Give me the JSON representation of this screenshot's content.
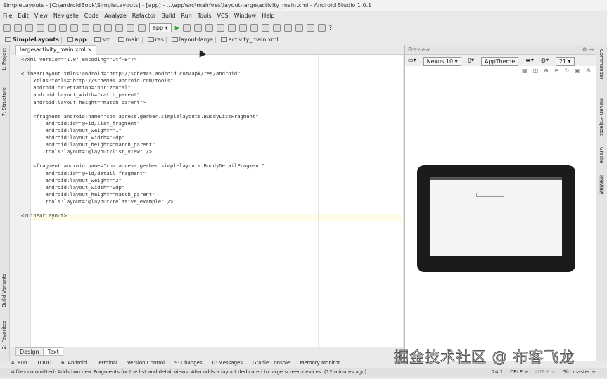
{
  "window": {
    "title": "SimpleLayouts - [C:\\androidBook\\SimpleLayouts] - [app] - ...\\app\\src\\main\\res\\layout-large\\activity_main.xml - Android Studio 1.0.1"
  },
  "menu": [
    "File",
    "Edit",
    "View",
    "Navigate",
    "Code",
    "Analyze",
    "Refactor",
    "Build",
    "Run",
    "Tools",
    "VCS",
    "Window",
    "Help"
  ],
  "toolbar": {
    "run_config": "app ▾",
    "help": "?"
  },
  "breadcrumbs": [
    "SimpleLayouts",
    "app",
    "src",
    "main",
    "res",
    "layout-large",
    "activity_main.xml"
  ],
  "editor_tab": {
    "label": "large\\activity_main.xml",
    "close": "×"
  },
  "left_tools": [
    "1: Project",
    "7: Structure",
    "Build Variants",
    "2: Favorites"
  ],
  "right_tools": [
    "Commander",
    "Maven Projects",
    "Gradle",
    "Preview"
  ],
  "code": [
    "<?xml version=\"1.0\" encoding=\"utf-8\"?>",
    "",
    "<LinearLayout xmlns:android=\"http://schemas.android.com/apk/res/android\"",
    "    xmlns:tools=\"http://schemas.android.com/tools\"",
    "    android:orientation=\"horizontal\"",
    "    android:layout_width=\"match_parent\"",
    "    android:layout_height=\"match_parent\">",
    "",
    "    <fragment android:name=\"com.apress.gerber.simplelayouts.BuddyListFragment\"",
    "        android:id=\"@+id/list_fragment\"",
    "        android:layout_weight=\"1\"",
    "        android:layout_width=\"0dp\"",
    "        android:layout_height=\"match_parent\"",
    "        tools:layout=\"@layout/list_view\" />",
    "",
    "    <fragment android:name=\"com.apress.gerber.simplelayouts.BuddyDetailFragment\"",
    "        android:id=\"@+id/detail_fragment\"",
    "        android:layout_weight=\"2\"",
    "        android:layout_width=\"0dp\"",
    "        android:layout_height=\"match_parent\"",
    "        tools:layout=\"@layout/relative_example\" />",
    "",
    "</LinearLayout>"
  ],
  "preview": {
    "title": "Preview",
    "device": "Nexus 10 ▾",
    "theme": "AppTheme",
    "api": "21 ▾"
  },
  "design_tabs": [
    "Design",
    "Text"
  ],
  "tool_windows": [
    "4: Run",
    "TODO",
    "6: Android",
    "Terminal",
    "Version Control",
    "9: Changes",
    "0: Messages",
    "Gradle Console",
    "Memory Monitor"
  ],
  "status": {
    "message": "4 files committed: Adds two new Fragments for the list and detail views. Also adds a layout dedicated to large screen devices. (12 minutes ago)",
    "position": "24:1",
    "line_sep": "CRLF ÷",
    "encoding": "UTF-8 ÷",
    "vcs": "Git: master ÷"
  },
  "watermark": "掘金技术社区 @ 布客飞龙"
}
